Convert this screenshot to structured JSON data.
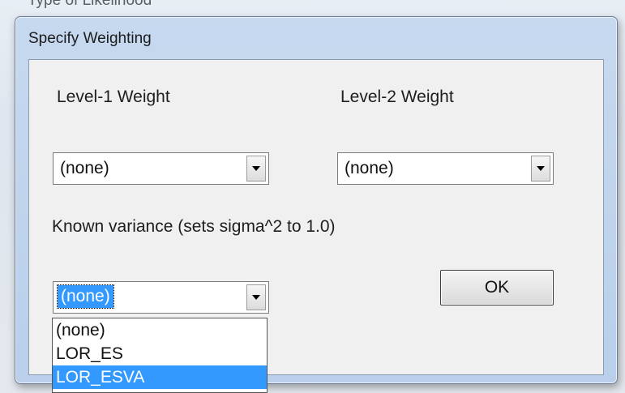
{
  "background": {
    "title": "Type of Likelihood"
  },
  "dialog": {
    "title": "Specify Weighting",
    "level1": {
      "label": "Level-1 Weight",
      "value": "(none)"
    },
    "level2": {
      "label": "Level-2 Weight",
      "value": "(none)"
    },
    "known_variance": {
      "label": "Known variance (sets sigma^2 to 1.0)",
      "value": "(none)",
      "options": [
        "(none)",
        "LOR_ES",
        "LOR_ESVA"
      ],
      "highlighted_option": "LOR_ESVA"
    },
    "ok_label": "OK"
  },
  "colors": {
    "selection": "#3399ff",
    "dialog_frame": "#c7d9ef",
    "client_bg": "#f0f0f0"
  }
}
